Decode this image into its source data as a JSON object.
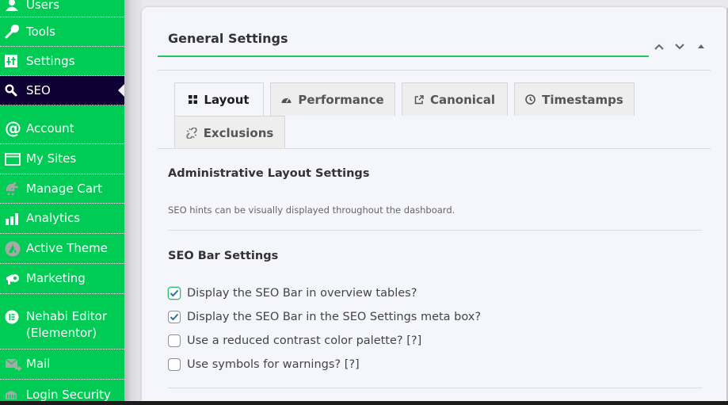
{
  "sidebar": {
    "items": [
      {
        "label": "Users",
        "icon": "users-icon"
      },
      {
        "label": "Tools",
        "icon": "wrench-icon"
      },
      {
        "label": "Settings",
        "icon": "settings-sliders-icon"
      },
      {
        "label": "SEO",
        "icon": "search-icon",
        "active": true
      },
      {
        "label": "Account",
        "icon": "at-sign-icon"
      },
      {
        "label": "My Sites",
        "icon": "browser-window-icon"
      },
      {
        "label": "Manage Cart",
        "icon": "cartflows-icon"
      },
      {
        "label": "Analytics",
        "icon": "bar-chart-icon"
      },
      {
        "label": "Active Theme",
        "icon": "astra-theme-icon"
      },
      {
        "label": "Marketing",
        "icon": "megaphone-icon"
      },
      {
        "label": "Nehabi Editor (Elementor)",
        "label_line1": "Nehabi Editor",
        "label_line2": "(Elementor)",
        "icon": "elementor-icon"
      },
      {
        "label": "Mail",
        "icon": "mail-icon"
      },
      {
        "label": "Login Security",
        "icon": "login-security-icon"
      }
    ]
  },
  "panel": {
    "title": "General Settings",
    "controls": [
      "move-up",
      "move-down",
      "toggle"
    ],
    "tabs": [
      {
        "label": "Layout",
        "icon": "grid-icon",
        "active": true
      },
      {
        "label": "Performance",
        "icon": "dashboard-gauge-icon"
      },
      {
        "label": "Canonical",
        "icon": "external-link-icon"
      },
      {
        "label": "Timestamps",
        "icon": "clock-icon"
      },
      {
        "label": "Exclusions",
        "icon": "broken-link-icon"
      }
    ],
    "admin_layout": {
      "heading": "Administrative Layout Settings",
      "description": "SEO hints can be visually displayed throughout the dashboard."
    },
    "seo_bar": {
      "heading": "SEO Bar Settings",
      "options": [
        {
          "label": "Display the SEO Bar in overview tables?",
          "checked": true
        },
        {
          "label": "Display the SEO Bar in the SEO Settings meta box?",
          "checked": true
        },
        {
          "label": "Use a reduced contrast color palette? [?]",
          "checked": false
        },
        {
          "label": "Use symbols for warnings? [?]",
          "checked": false
        }
      ]
    }
  },
  "colors": {
    "sidebar_bg": "#00cc55",
    "sidebar_active_bg": "#0e0033",
    "accent": "#22c55e",
    "checkbox_check": "#2271b1"
  }
}
